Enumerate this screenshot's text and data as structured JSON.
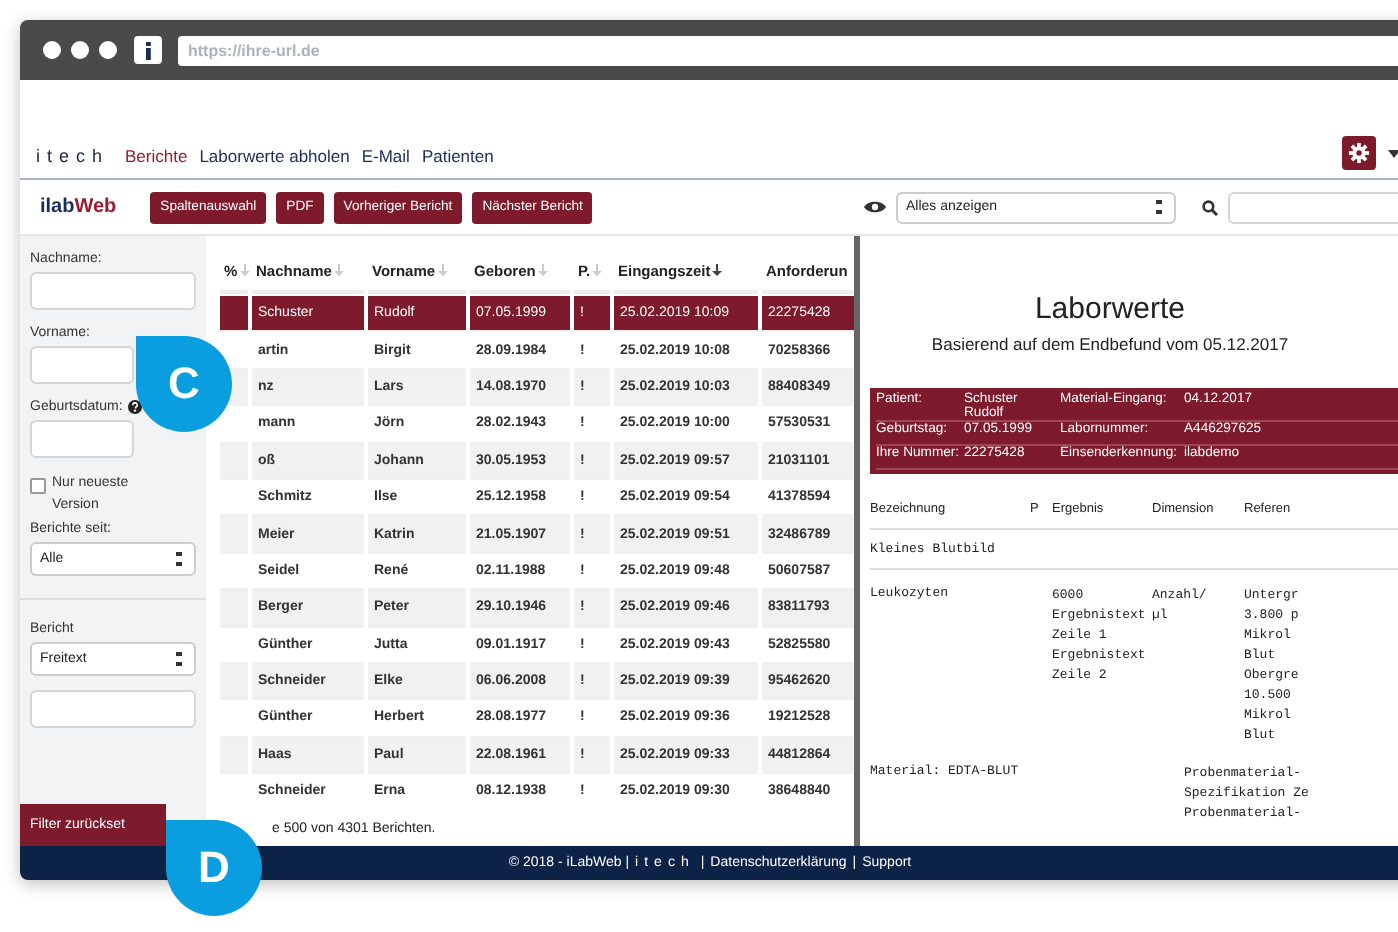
{
  "browser": {
    "url": "https://ihre-url.de"
  },
  "nav": {
    "logo": "itech",
    "links": [
      {
        "label": "Berichte",
        "selected": true
      },
      {
        "label": "Laborwerte abholen",
        "selected": false
      },
      {
        "label": "E-Mail",
        "selected": false
      },
      {
        "label": "Patienten",
        "selected": false
      }
    ]
  },
  "toolbar": {
    "brand_a": "ilab",
    "brand_b": "Web",
    "buttons": [
      "Spaltenauswahl",
      "PDF",
      "Vorheriger Bericht",
      "Nächster Bericht"
    ],
    "view_select": "Alles anzeigen"
  },
  "sidebar": {
    "nachname_label": "Nachname:",
    "vorname_label": "Vorname:",
    "geburtsdatum_label": "Geburtsdatum:",
    "newest_only": {
      "label": "Nur neueste Version",
      "checked": false
    },
    "since": {
      "label": "Berichte seit:",
      "value": "Alle"
    },
    "report": {
      "label": "Bericht",
      "value": "Freitext"
    },
    "reset_button": "Filter zurückset"
  },
  "table": {
    "columns": [
      {
        "label": "%",
        "sorted": false
      },
      {
        "label": "Nachname",
        "sorted": false
      },
      {
        "label": "Vorname",
        "sorted": false
      },
      {
        "label": "Geboren",
        "sorted": false
      },
      {
        "label": "P.",
        "sorted": false
      },
      {
        "label": "Eingangszeit",
        "sorted": true
      },
      {
        "label": "Anforderun"
      }
    ],
    "rows": [
      {
        "selected": true,
        "cells": [
          "",
          "Schuster",
          "Rudolf",
          "07.05.1999",
          "!",
          "25.02.2019 10:09",
          "22275428"
        ]
      },
      {
        "selected": false,
        "cells": [
          "",
          "artin",
          "Birgit",
          "28.09.1984",
          "!",
          "25.02.2019 10:08",
          "70258366"
        ]
      },
      {
        "selected": false,
        "cells": [
          "",
          "nz",
          "Lars",
          "14.08.1970",
          "!",
          "25.02.2019 10:03",
          "88408349"
        ]
      },
      {
        "selected": false,
        "cells": [
          "",
          "mann",
          "Jörn",
          "28.02.1943",
          "!",
          "25.02.2019 10:00",
          "57530531"
        ]
      },
      {
        "selected": false,
        "cells": [
          "",
          "oß",
          "Johann",
          "30.05.1953",
          "!",
          "25.02.2019 09:57",
          "21031101"
        ]
      },
      {
        "selected": false,
        "cells": [
          "",
          "Schmitz",
          "Ilse",
          "25.12.1958",
          "!",
          "25.02.2019 09:54",
          "41378594"
        ]
      },
      {
        "selected": false,
        "cells": [
          "",
          "Meier",
          "Katrin",
          "21.05.1907",
          "!",
          "25.02.2019 09:51",
          "32486789"
        ]
      },
      {
        "selected": false,
        "cells": [
          "",
          "Seidel",
          "René",
          "02.11.1988",
          "!",
          "25.02.2019 09:48",
          "50607587"
        ]
      },
      {
        "selected": false,
        "cells": [
          "",
          "Berger",
          "Peter",
          "29.10.1946",
          "!",
          "25.02.2019 09:46",
          "83811793"
        ]
      },
      {
        "selected": false,
        "cells": [
          "",
          "Günther",
          "Jutta",
          "09.01.1917",
          "!",
          "25.02.2019 09:43",
          "52825580"
        ]
      },
      {
        "selected": false,
        "cells": [
          "",
          "Schneider",
          "Elke",
          "06.06.2008",
          "!",
          "25.02.2019 09:39",
          "95462620"
        ]
      },
      {
        "selected": false,
        "cells": [
          "",
          "Günther",
          "Herbert",
          "28.08.1977",
          "!",
          "25.02.2019 09:36",
          "19212528"
        ]
      },
      {
        "selected": false,
        "cells": [
          "",
          "Haas",
          "Paul",
          "22.08.1961",
          "!",
          "25.02.2019 09:33",
          "44812864"
        ]
      },
      {
        "selected": false,
        "cells": [
          "",
          "Schneider",
          "Erna",
          "08.12.1938",
          "!",
          "25.02.2019 09:30",
          "38648840"
        ]
      }
    ],
    "summary": "e 500 von 4301 Berichten."
  },
  "report": {
    "title": "Laborwerte",
    "subtitle": "Basierend auf dem Endbefund vom 05.12.2017",
    "info": [
      [
        "Patient:",
        "Schuster Rudolf",
        "Material-Eingang:",
        "04.12.2017"
      ],
      [
        "Geburtstag:",
        "07.05.1999",
        "Labornummer:",
        "A446297625"
      ],
      [
        "Ihre Nummer:",
        "22275428",
        "Einsenderkennung:",
        "ilabdemo"
      ]
    ],
    "columns": [
      "Bezeichnung",
      "P",
      "Ergebnis",
      "Dimension",
      "Referen"
    ],
    "section": "Kleines Blutbild",
    "result": {
      "name": "Leukozyten",
      "value_lines": [
        "6000",
        "Ergebnistext",
        "Zeile 1",
        "Ergebnistext",
        "Zeile 2"
      ],
      "dimension_lines": [
        "Anzahl/",
        "µl"
      ],
      "reference_lines": [
        "Untergr",
        "3.800 p",
        "Mikrol",
        "Blut",
        "Obergre",
        "10.500",
        "Mikrol",
        "Blut"
      ]
    },
    "material": "Material: EDTA-BLUT",
    "material_lines": [
      "Probenmaterial-",
      "Spezifikation Ze",
      "Probenmaterial-"
    ]
  },
  "footer": [
    {
      "kind": "text",
      "text": "© 2018 - iLabWeb |"
    },
    {
      "kind": "logo",
      "text": "itech"
    },
    {
      "kind": "text",
      "text": "|"
    },
    {
      "kind": "link",
      "text": "Datenschutzerklärung"
    },
    {
      "kind": "text",
      "text": "|"
    },
    {
      "kind": "link",
      "text": "Support"
    }
  ],
  "callouts": [
    "C",
    "D"
  ]
}
